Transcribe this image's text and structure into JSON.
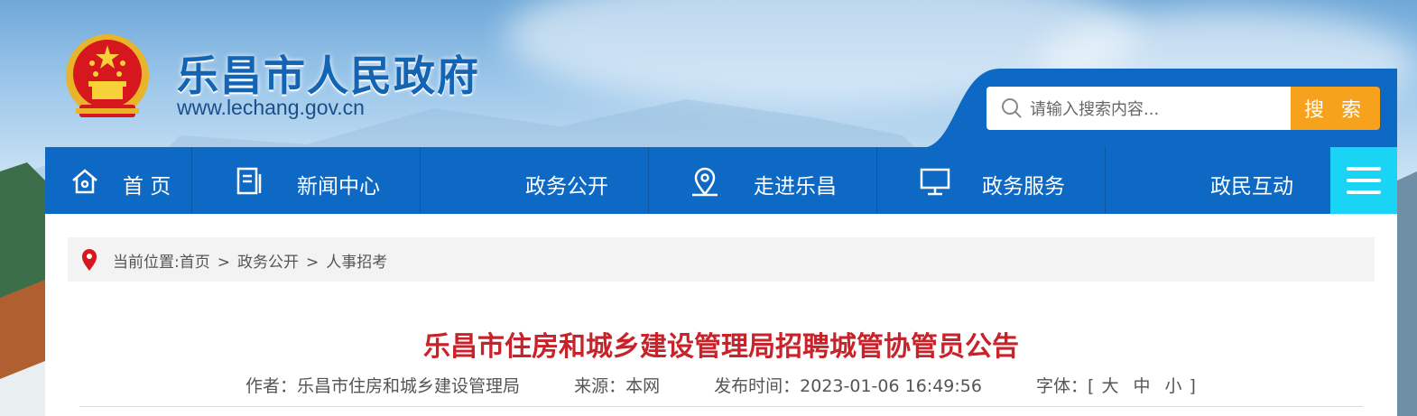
{
  "site": {
    "name": "乐昌市人民政府",
    "url": "www.lechang.gov.cn"
  },
  "search": {
    "placeholder": "请输入搜索内容...",
    "button_label": "搜 索"
  },
  "nav": {
    "items": [
      {
        "label": "首 页",
        "icon": "home-icon"
      },
      {
        "label": "新闻中心",
        "icon": "document-icon"
      },
      {
        "label": "政务公开",
        "icon": ""
      },
      {
        "label": "走进乐昌",
        "icon": "location-icon"
      },
      {
        "label": "政务服务",
        "icon": "monitor-icon"
      },
      {
        "label": "政民互动",
        "icon": ""
      }
    ],
    "menu_icon": "menu-icon"
  },
  "breadcrumb": {
    "prefix": "当前位置:",
    "items": [
      "首页",
      "政务公开",
      "人事招考"
    ],
    "separator": ">"
  },
  "article": {
    "title": "乐昌市住房和城乡建设管理局招聘城管协管员公告",
    "author_label": "作者：",
    "author": "乐昌市住房和城乡建设管理局",
    "source_label": "来源：",
    "source": "本网",
    "time_label": "发布时间：",
    "time": "2023-01-06 16:49:56",
    "font_label": "字体：",
    "font_open": "[",
    "font_sizes": [
      "大",
      "中",
      "小"
    ],
    "font_close": "]"
  },
  "colors": {
    "nav": "#0d69c4",
    "accent": "#f7a21d",
    "title": "#c8222a",
    "menu": "#1ad4f5"
  }
}
